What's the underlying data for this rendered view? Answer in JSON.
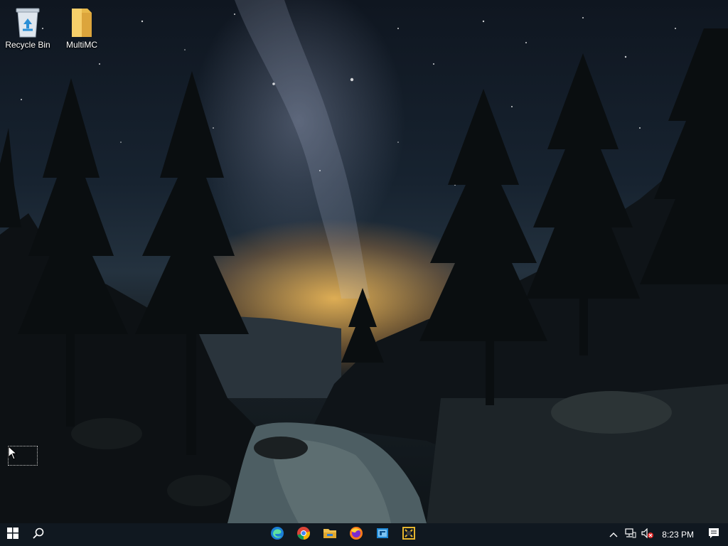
{
  "desktop": {
    "icons": [
      {
        "label": "Recycle Bin",
        "icon": "recycle-bin-icon"
      },
      {
        "label": "MultiMC",
        "icon": "folder-icon"
      }
    ]
  },
  "taskbar": {
    "start": {
      "icon": "windows-logo-icon"
    },
    "search": {
      "icon": "search-icon"
    },
    "apps": [
      {
        "name": "Microsoft Edge",
        "icon": "edge-icon"
      },
      {
        "name": "Google Chrome",
        "icon": "chrome-icon"
      },
      {
        "name": "File Explorer",
        "icon": "file-explorer-icon"
      },
      {
        "name": "Firefox",
        "icon": "firefox-icon"
      },
      {
        "name": "App",
        "icon": "app-blue-icon"
      },
      {
        "name": "App",
        "icon": "app-yellow-icon"
      }
    ],
    "tray": {
      "chevron_icon": "chevron-up-icon",
      "network_icon": "network-icon",
      "volume_icon": "volume-muted-icon",
      "time": "8:23 PM",
      "notifications_icon": "notification-icon"
    }
  },
  "colors": {
    "taskbar": "#101820",
    "accent": "#0078d7"
  }
}
